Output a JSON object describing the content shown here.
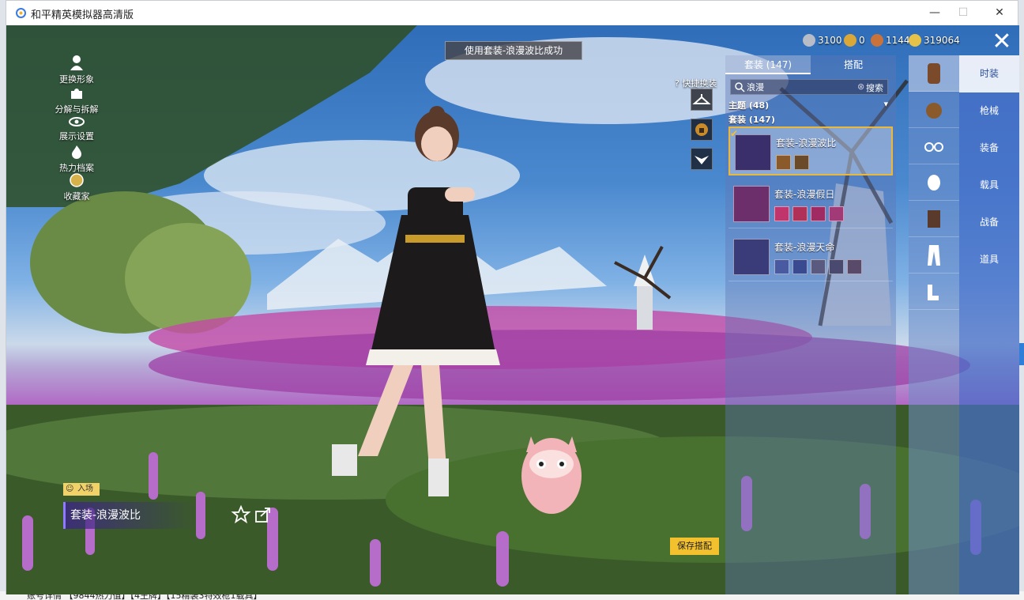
{
  "window": {
    "title": "和平精英模拟器高清版",
    "minimize": "—",
    "maximize": "☐",
    "close": "✕"
  },
  "game": {
    "toast": "使用套装-浪漫波比成功",
    "left_menu": [
      {
        "label": "更换形象",
        "icon": "avatar-icon"
      },
      {
        "label": "分解与拆解",
        "icon": "puzzle-icon"
      },
      {
        "label": "展示设置",
        "icon": "eye-icon"
      },
      {
        "label": "热力档案",
        "icon": "flame-icon"
      },
      {
        "label": "收藏家",
        "icon": "collector-icon"
      }
    ],
    "currencies": [
      {
        "value": "3100",
        "color": "#b7bcc7"
      },
      {
        "value": "0",
        "color": "#d9a838"
      },
      {
        "value": "1144",
        "color": "#c9733a"
      },
      {
        "value": "319064",
        "color": "#e7c248"
      }
    ],
    "close_label": "✕",
    "quick_change_label": "快捷换装",
    "panel": {
      "tabs": [
        "套装 (147)",
        "搭配"
      ],
      "search_value": "浪漫",
      "search_label": "搜索",
      "theme_label": "主题 (48)",
      "suits_label": "套装 (147)",
      "items": [
        {
          "name": "套装-浪漫波比",
          "color": "#3b2f6b",
          "subs": [
            "#8b5a2b",
            "#6b4a2a"
          ]
        },
        {
          "name": "套装-浪漫假日",
          "color": "#6d2f6b",
          "subs": [
            "#c0356b",
            "#b03058",
            "#a02a62",
            "#a33a78"
          ]
        },
        {
          "name": "套装-浪漫天命",
          "color": "#3a3c7a",
          "subs": [
            "#4a5aa0",
            "#3a4a90",
            "#5a5a80",
            "#4a4a70",
            "#5a4a6a"
          ]
        }
      ]
    },
    "category_icons": [
      "costume-icon",
      "helmet-icon",
      "glasses-icon",
      "mask-icon",
      "top-icon",
      "pants-icon",
      "shoes-icon"
    ],
    "top_nav": [
      "时装",
      "枪械",
      "装备",
      "载具",
      "战备",
      "道具"
    ],
    "nameplate": "套装-浪漫波比",
    "entry_tag": "入场",
    "save_button": "保存搭配"
  },
  "desktop_strip": "账号详情   【9844热力值】【4王牌】【15精装3特效枪1载具】"
}
